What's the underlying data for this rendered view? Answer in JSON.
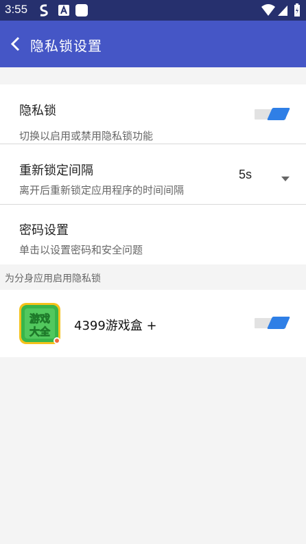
{
  "status_bar": {
    "time": "3:55",
    "icons": [
      "s-app-icon",
      "a-app-icon",
      "square-app-icon",
      "wifi-icon",
      "signal-icon",
      "battery-icon"
    ]
  },
  "header": {
    "back_icon": "chevron-left-icon",
    "title": "隐私锁设置"
  },
  "settings": {
    "privacy_lock": {
      "title": "隐私锁",
      "subtitle": "切换以启用或禁用隐私锁功能",
      "enabled": true
    },
    "relock_interval": {
      "title": "重新锁定间隔",
      "subtitle": "离开后重新锁定应用程序的时间间隔",
      "value": "5s"
    },
    "password": {
      "title": "密码设置",
      "subtitle": "单击以设置密码和安全问题"
    }
  },
  "clone_apps": {
    "section_title": "为分身应用启用隐私锁",
    "apps": [
      {
        "icon_text": "游戏大全",
        "name": "4399游戏盒 +",
        "enabled": true
      }
    ]
  },
  "colors": {
    "status_bar": "#26306e",
    "app_bar": "#4556c6",
    "toggle_on": "#2f7fe6",
    "background": "#f4f4f4"
  }
}
